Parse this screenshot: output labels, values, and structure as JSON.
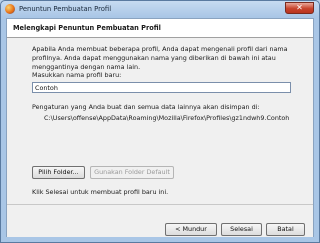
{
  "window": {
    "title": "Penuntun Pembuatan Profil",
    "close_glyph": "✕"
  },
  "header": {
    "title": "Melengkapi Penuntun Pembuatan Profil"
  },
  "body": {
    "intro": "Apabila Anda membuat beberapa profil, Anda dapat mengenali profil dari nama profilnya. Anda dapat menggunakan nama yang diberikan di bawah ini atau menggantinya dengan nama lain.",
    "name_label": "Masukkan nama profil baru:",
    "name_value": "Contoh",
    "storage_text": "Pengaturan yang Anda buat dan semua data lainnya akan disimpan di:",
    "profile_path": "C:\\Users\\offense\\AppData\\Roaming\\Mozilla\\Firefox\\Profiles\\gz1ndwh9.Contoh",
    "choose_folder_label": "Pilih Folder...",
    "default_folder_label": "Gunakan Folder Default",
    "finish_hint": "Klik Selesai untuk membuat profil baru ini."
  },
  "footer": {
    "back_label": "< Mundur",
    "finish_label": "Selesai",
    "cancel_label": "Batal"
  }
}
